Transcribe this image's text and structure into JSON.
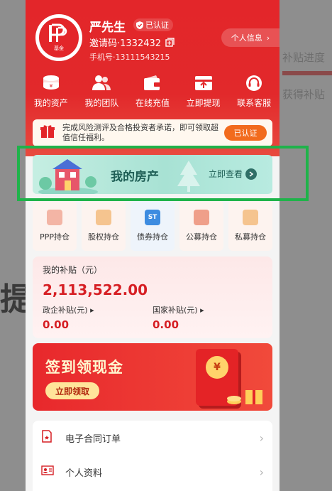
{
  "user": {
    "name": "严先生",
    "verified_label": "已认证",
    "invite_code": "邀请码·1332432",
    "phone": "手机号·13111543215",
    "logo_caption": "基金",
    "profile_button": "个人信息"
  },
  "quick_actions": [
    {
      "label": "我的资产",
      "icon": "coin-stack-icon"
    },
    {
      "label": "我的团队",
      "icon": "team-icon"
    },
    {
      "label": "在线充值",
      "icon": "wallet-icon"
    },
    {
      "label": "立即提现",
      "icon": "withdraw-icon"
    },
    {
      "label": "联系客服",
      "icon": "headset-icon"
    }
  ],
  "notice": {
    "text": "完成风险测评及合格投资者承诺，即可领取超值信任福利。",
    "button": "已认证"
  },
  "property_banner": {
    "title": "我的房产",
    "cta": "立即查看"
  },
  "holdings": [
    {
      "label": "PPP持仓"
    },
    {
      "label": "股权持仓"
    },
    {
      "label": "债券持仓",
      "icon_text": "ST"
    },
    {
      "label": "公募持仓"
    },
    {
      "label": "私募持仓"
    }
  ],
  "subsidy": {
    "label": "我的补贴（元）",
    "total": "2,113,522.00",
    "gov_label": "政企补贴(元)",
    "gov_value": "0.00",
    "national_label": "国家补贴(元)",
    "national_value": "0.00"
  },
  "checkin": {
    "title": "签到领现金",
    "button": "立即领取",
    "coin_symbol": "¥"
  },
  "menu": [
    {
      "label": "电子合同订单",
      "icon": "contract-icon"
    },
    {
      "label": "个人资料",
      "icon": "id-card-icon"
    }
  ],
  "backdrop": {
    "line1": "补贴进度",
    "line2": "获得补贴",
    "big_char": "提"
  },
  "colors": {
    "brand_red": "#e3262a",
    "highlight_green": "#1fb34a",
    "banner_teal": "#a8e2d4",
    "cert_orange": "#f26b1d"
  }
}
